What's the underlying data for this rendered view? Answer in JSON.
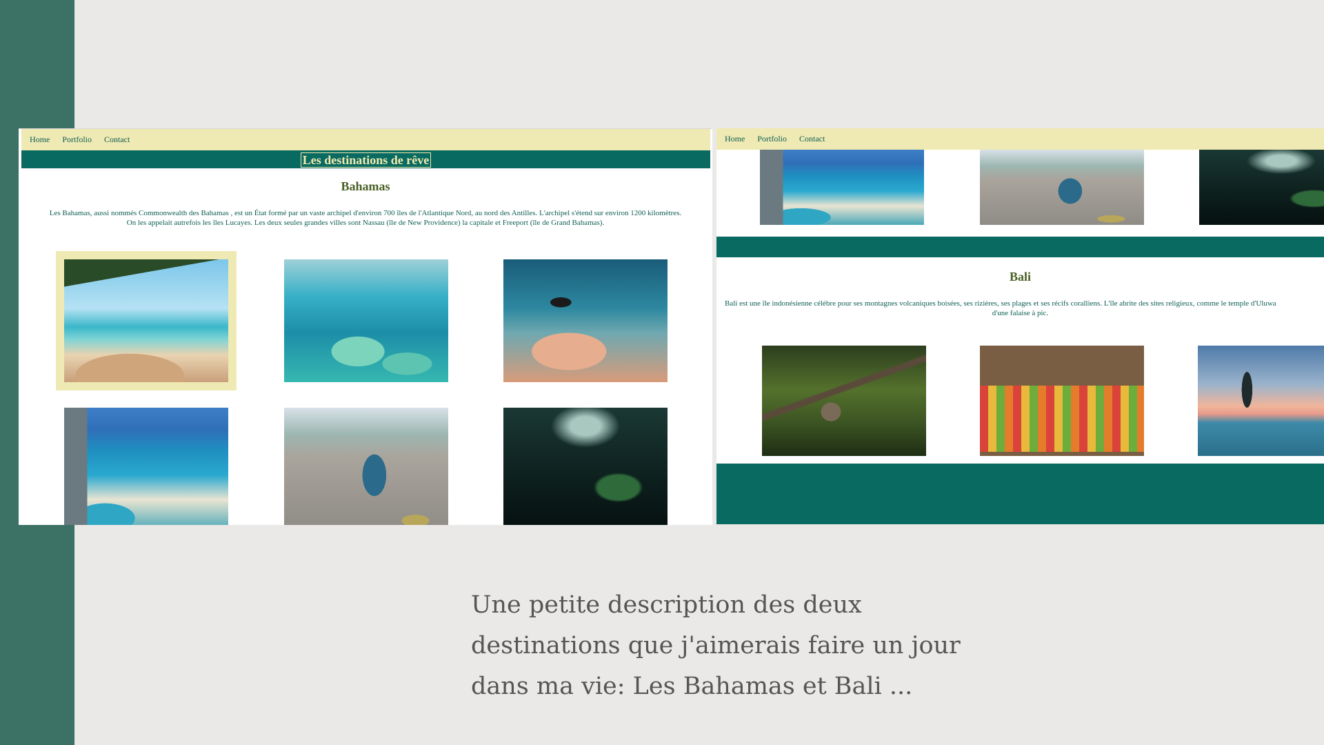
{
  "nav": {
    "home": "Home",
    "portfolio": "Portfolio",
    "contact": "Contact"
  },
  "site_title": "Les destinations de rêve",
  "bahamas": {
    "heading": "Bahamas",
    "description_line1": "Les Bahamas, aussi nommés Commonwealth des Bahamas , est un État formé par un vaste archipel d'environ 700 îles de l'Atlantique Nord, au nord des Antilles. L'archipel s'étend sur environ 1200 kilomètres.",
    "description_line2": "On les appelait autrefois les îles Lucayes. Les deux seules grandes villes sont Nassau (île de New Providence) la capitale et Freeport (île de Grand Bahamas).",
    "photos": [
      "palm-beach-photo",
      "aerial-reef-photo",
      "diver-photo",
      "hotel-coast-photo",
      "coconut-vendor-photo",
      "underwater-cave-photo"
    ]
  },
  "bali": {
    "heading": "Bali",
    "description_line1": "Bali est une île indonésienne célèbre pour ses montagnes volcaniques boisées, ses rizières, ses plages et ses récifs coralliens. L'île abrite des sites religieux, comme le temple d'Uluwa",
    "description_line2": "d'une falaise à pic.",
    "photos": [
      "monkey-photo",
      "fruit-market-photo",
      "infinity-pool-sunset-photo"
    ]
  },
  "caption": "Une  petite description des deux\ndestinations que j'aimerais faire un jour\ndans ma vie: Les Bahamas et Bali ...",
  "colors": {
    "teal": "#086a60",
    "nav_bg": "#efe9b3",
    "band": "#3c7265",
    "background": "#eae9e7"
  }
}
